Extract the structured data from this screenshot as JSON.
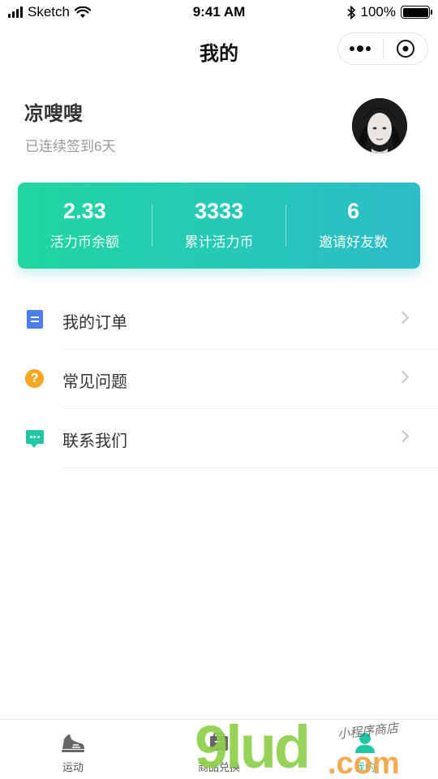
{
  "status_bar": {
    "carrier": "Sketch",
    "time": "9:41 AM",
    "battery": "100%"
  },
  "nav": {
    "title": "我的"
  },
  "profile": {
    "name": "凉嗖嗖",
    "checkin_text": "已连续签到6天"
  },
  "stats": [
    {
      "value": "2.33",
      "label": "活力币余额"
    },
    {
      "value": "3333",
      "label": "累计活力币"
    },
    {
      "value": "6",
      "label": "邀请好友数"
    }
  ],
  "menu": [
    {
      "label": "我的订单",
      "icon": "document-icon",
      "color": "#4b80ec"
    },
    {
      "label": "常见问题",
      "icon": "question-icon",
      "color": "#f5a623"
    },
    {
      "label": "联系我们",
      "icon": "chat-icon",
      "color": "#20c7a4"
    }
  ],
  "tabs": [
    {
      "label": "运动",
      "icon": "sneaker-icon",
      "active": false
    },
    {
      "label": "商品兑换",
      "icon": "exchange-icon",
      "active": false
    },
    {
      "label": "我的",
      "icon": "person-icon",
      "active": true
    }
  ],
  "watermark": {
    "brand": "9lud",
    "suffix": ".com",
    "slogan": "小程序商店"
  },
  "colors": {
    "accent": "#20c7a4",
    "card_gradient_start": "#20d6a0",
    "card_gradient_end": "#2dbcc9"
  }
}
